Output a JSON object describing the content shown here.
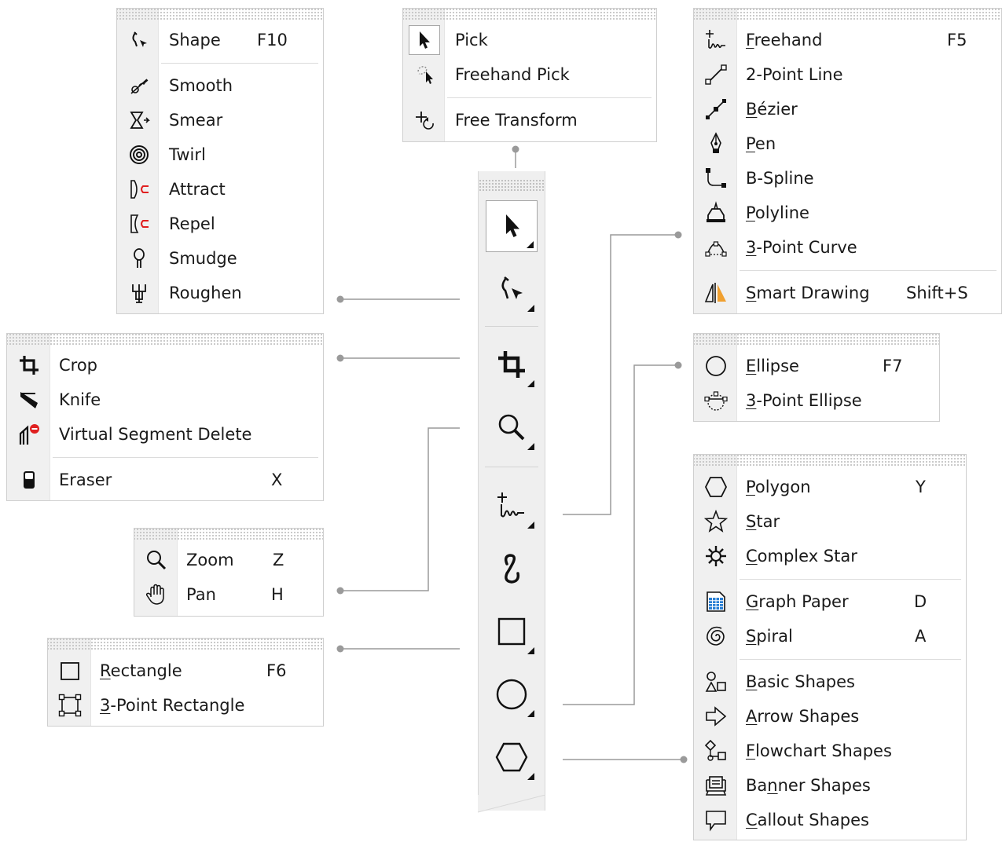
{
  "colors": {
    "accent_orange": "#f0a030",
    "red": "#e02020",
    "blue": "#2a7fd4"
  },
  "shape_menu": {
    "items": [
      {
        "label": "Shape",
        "shortcut": "F10",
        "icon": "shape-icon"
      },
      {
        "label": "Smooth",
        "shortcut": "",
        "icon": "smooth-icon"
      },
      {
        "label": "Smear",
        "shortcut": "",
        "icon": "smear-icon"
      },
      {
        "label": "Twirl",
        "shortcut": "",
        "icon": "twirl-icon"
      },
      {
        "label": "Attract",
        "shortcut": "",
        "icon": "attract-icon"
      },
      {
        "label": "Repel",
        "shortcut": "",
        "icon": "repel-icon"
      },
      {
        "label": "Smudge",
        "shortcut": "",
        "icon": "smudge-icon"
      },
      {
        "label": "Roughen",
        "shortcut": "",
        "icon": "roughen-icon"
      }
    ]
  },
  "pick_menu": {
    "items": [
      {
        "label": "Pick",
        "icon": "pick-arrow-icon"
      },
      {
        "label": "Freehand Pick",
        "icon": "freehand-pick-icon"
      },
      {
        "label": "Free Transform",
        "icon": "free-transform-icon"
      }
    ]
  },
  "crop_menu": {
    "items": [
      {
        "label": "Crop",
        "shortcut": "",
        "icon": "crop-icon"
      },
      {
        "label": "Knife",
        "shortcut": "",
        "icon": "knife-icon"
      },
      {
        "label": "Virtual Segment Delete",
        "shortcut": "",
        "icon": "virtual-segment-delete-icon"
      },
      {
        "label": "Eraser",
        "shortcut": "X",
        "icon": "eraser-icon"
      }
    ]
  },
  "zoom_menu": {
    "items": [
      {
        "label": "Zoom",
        "shortcut": "Z",
        "icon": "zoom-icon"
      },
      {
        "label": "Pan",
        "shortcut": "H",
        "icon": "pan-hand-icon"
      }
    ]
  },
  "rect_menu": {
    "items": [
      {
        "label_pre": "",
        "label_u": "R",
        "label_post": "ectangle",
        "shortcut": "F6",
        "icon": "rectangle-icon"
      },
      {
        "label_pre": "",
        "label_u": "3",
        "label_post": "-Point Rectangle",
        "shortcut": "",
        "icon": "three-point-rectangle-icon"
      }
    ]
  },
  "curve_menu": {
    "items": [
      {
        "label_pre": "",
        "label_u": "F",
        "label_post": "reehand",
        "shortcut": "F5",
        "icon": "freehand-icon"
      },
      {
        "label_pre": "2-Point Line",
        "label_u": "",
        "label_post": "",
        "shortcut": "",
        "icon": "two-point-line-icon"
      },
      {
        "label_pre": "",
        "label_u": "B",
        "label_post": "ézier",
        "shortcut": "",
        "icon": "bezier-icon"
      },
      {
        "label_pre": "",
        "label_u": "P",
        "label_post": "en",
        "shortcut": "",
        "icon": "pen-icon"
      },
      {
        "label_pre": "B-Spline",
        "label_u": "",
        "label_post": "",
        "shortcut": "",
        "icon": "b-spline-icon"
      },
      {
        "label_pre": "",
        "label_u": "P",
        "label_post": "olyline",
        "shortcut": "",
        "icon": "polyline-icon"
      },
      {
        "label_pre": "",
        "label_u": "3",
        "label_post": "-Point Curve",
        "shortcut": "",
        "icon": "three-point-curve-icon"
      },
      {
        "label_pre": "",
        "label_u": "S",
        "label_post": "mart Drawing",
        "shortcut": "Shift+S",
        "icon": "smart-drawing-icon"
      }
    ]
  },
  "ellipse_menu": {
    "items": [
      {
        "label_pre": "",
        "label_u": "E",
        "label_post": "llipse",
        "shortcut": "F7",
        "icon": "ellipse-icon"
      },
      {
        "label_pre": "",
        "label_u": "3",
        "label_post": "-Point Ellipse",
        "shortcut": "",
        "icon": "three-point-ellipse-icon"
      }
    ]
  },
  "polygon_menu": {
    "items": [
      {
        "label_pre": "",
        "label_u": "P",
        "label_post": "olygon",
        "shortcut": "Y",
        "icon": "polygon-icon"
      },
      {
        "label_pre": "",
        "label_u": "S",
        "label_post": "tar",
        "shortcut": "",
        "icon": "star-icon"
      },
      {
        "label_pre": "",
        "label_u": "C",
        "label_post": "omplex Star",
        "shortcut": "",
        "icon": "complex-star-icon"
      },
      {
        "label_pre": "",
        "label_u": "G",
        "label_post": "raph Paper",
        "shortcut": "D",
        "icon": "graph-paper-icon"
      },
      {
        "label_pre": "",
        "label_u": "S",
        "label_post": "piral",
        "shortcut": "A",
        "icon": "spiral-icon"
      },
      {
        "label_pre": "",
        "label_u": "B",
        "label_post": "asic Shapes",
        "shortcut": "",
        "icon": "basic-shapes-icon"
      },
      {
        "label_pre": "",
        "label_u": "A",
        "label_post": "rrow Shapes",
        "shortcut": "",
        "icon": "arrow-shapes-icon"
      },
      {
        "label_pre": "",
        "label_u": "F",
        "label_post": "lowchart Shapes",
        "shortcut": "",
        "icon": "flowchart-shapes-icon"
      },
      {
        "label_pre": "Ba",
        "label_u": "n",
        "label_post": "ner Shapes",
        "shortcut": "",
        "icon": "banner-shapes-icon"
      },
      {
        "label_pre": "",
        "label_u": "C",
        "label_post": "allout Shapes",
        "shortcut": "",
        "icon": "callout-shapes-icon"
      }
    ]
  },
  "toolbox": {
    "buttons": [
      {
        "name": "pick-tool",
        "icon": "pick-arrow-icon",
        "selected": true
      },
      {
        "name": "shape-tool",
        "icon": "shape-icon"
      },
      {
        "name": "crop-tool",
        "icon": "crop-icon"
      },
      {
        "name": "zoom-tool",
        "icon": "zoom-icon"
      },
      {
        "name": "freehand-tool",
        "icon": "freehand-icon"
      },
      {
        "name": "artistic-media-tool",
        "icon": "artistic-media-icon"
      },
      {
        "name": "rectangle-tool",
        "icon": "rectangle-icon"
      },
      {
        "name": "ellipse-tool",
        "icon": "ellipse-icon"
      },
      {
        "name": "polygon-tool",
        "icon": "polygon-icon"
      }
    ]
  }
}
